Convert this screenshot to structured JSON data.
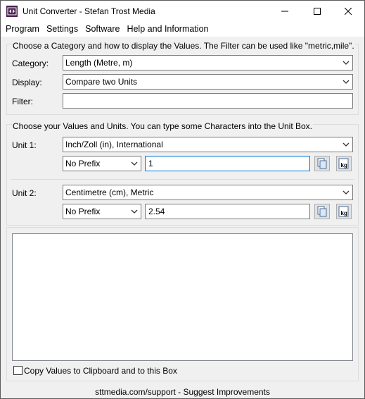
{
  "window": {
    "title": "Unit Converter - Stefan Trost Media",
    "icon": "converter-app-icon"
  },
  "menu": [
    "Program",
    "Settings",
    "Software",
    "Help and Information"
  ],
  "category_group": {
    "caption": "Choose a Category and how to display the Values. The Filter can be used like \"metric,mile\".",
    "category_label": "Category:",
    "category_value": "Length (Metre, m)",
    "display_label": "Display:",
    "display_value": "Compare two Units",
    "filter_label": "Filter:",
    "filter_value": ""
  },
  "values_group": {
    "caption": "Choose your Values and Units. You can type some Characters into the Unit Box.",
    "unit1_label": "Unit 1:",
    "unit1_value": "Inch/Zoll (in), International",
    "unit1_prefix": "No Prefix",
    "unit1_amount": "1",
    "unit2_label": "Unit 2:",
    "unit2_value": "Centimetre (cm), Metric",
    "unit2_prefix": "No Prefix",
    "unit2_amount": "2.54",
    "icons": [
      "copy-icon",
      "kg-icon"
    ]
  },
  "output": {
    "checkbox_label": "Copy Values to Clipboard and to this Box",
    "checked": false
  },
  "footer": {
    "link": "sttmedia.com/support - Suggest Improvements"
  }
}
